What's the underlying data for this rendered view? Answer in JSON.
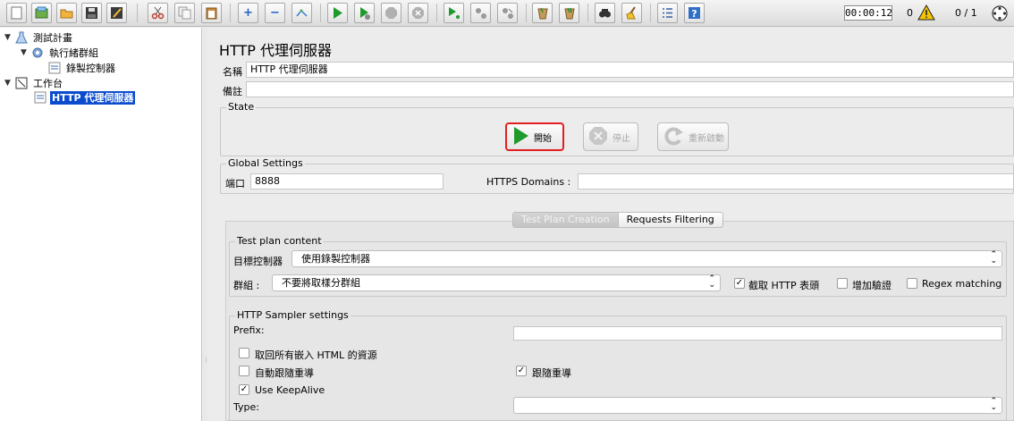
{
  "toolbar": {
    "icons": [
      "new-icon",
      "templates-icon",
      "open-icon",
      "save-icon",
      "save-as-icon",
      "cut-icon",
      "copy-icon",
      "paste-icon",
      "expand-icon",
      "collapse-icon",
      "toggle-icon",
      "start-icon",
      "start-no-pause-icon",
      "stop-icon",
      "shutdown-icon",
      "remote-start-icon",
      "remote-stop-icon",
      "remote-shutdown-icon",
      "clear-icon",
      "clear-all-icon",
      "search-icon",
      "reset-search-icon",
      "function-helper-icon",
      "help-icon"
    ],
    "timer": "00:00:12",
    "warning_count": "0",
    "thread_count": "0 / 1"
  },
  "tree": {
    "items": [
      {
        "label": "測試計畫",
        "icon": "test-plan-icon"
      },
      {
        "label": "執行緒群組",
        "icon": "thread-group-icon"
      },
      {
        "label": "錄製控制器",
        "icon": "recording-controller-icon"
      },
      {
        "label": "工作台",
        "icon": "workbench-icon"
      },
      {
        "label": "HTTP 代理伺服器",
        "icon": "proxy-server-icon",
        "selected": true
      }
    ]
  },
  "panel": {
    "title": "HTTP 代理伺服器",
    "name_label": "名稱",
    "name_value": "HTTP 代理伺服器",
    "comment_label": "備註",
    "comment_value": "",
    "state": {
      "legend": "State",
      "start_label": "開始",
      "stop_label": "停止",
      "restart_label": "重新啟動"
    },
    "global": {
      "legend": "Global Settings",
      "port_label": "端口",
      "port_value": "8888",
      "https_label": "HTTPS Domains :",
      "https_value": ""
    },
    "tabs": [
      "Test Plan Creation",
      "Requests Filtering"
    ],
    "test_plan": {
      "legend": "Test plan content",
      "target_label": "目標控制器",
      "target_value": "使用錄製控制器",
      "group_label": "群組 :",
      "group_value": "不要將取樣分群組",
      "capture_headers_label": "截取 HTTP 表頭",
      "capture_headers_checked": true,
      "add_assertions_label": "增加驗證",
      "add_assertions_checked": false,
      "regex_label": "Regex matching",
      "regex_checked": false
    },
    "sampler": {
      "legend": "HTTP Sampler settings",
      "prefix_label": "Prefix:",
      "prefix_value": "",
      "embedded_label": "取回所有嵌入 HTML 的資源",
      "embedded_checked": false,
      "auto_redirect_label": "自動跟隨重導",
      "auto_redirect_checked": false,
      "follow_redirect_label": "跟隨重導",
      "follow_redirect_checked": true,
      "keepalive_label": "Use KeepAlive",
      "keepalive_checked": true,
      "type_label": "Type:",
      "type_value": ""
    }
  },
  "colors": {
    "selection": "#0b4ccf",
    "highlight_border": "#e02020",
    "start_green": "#1f9a2c"
  }
}
